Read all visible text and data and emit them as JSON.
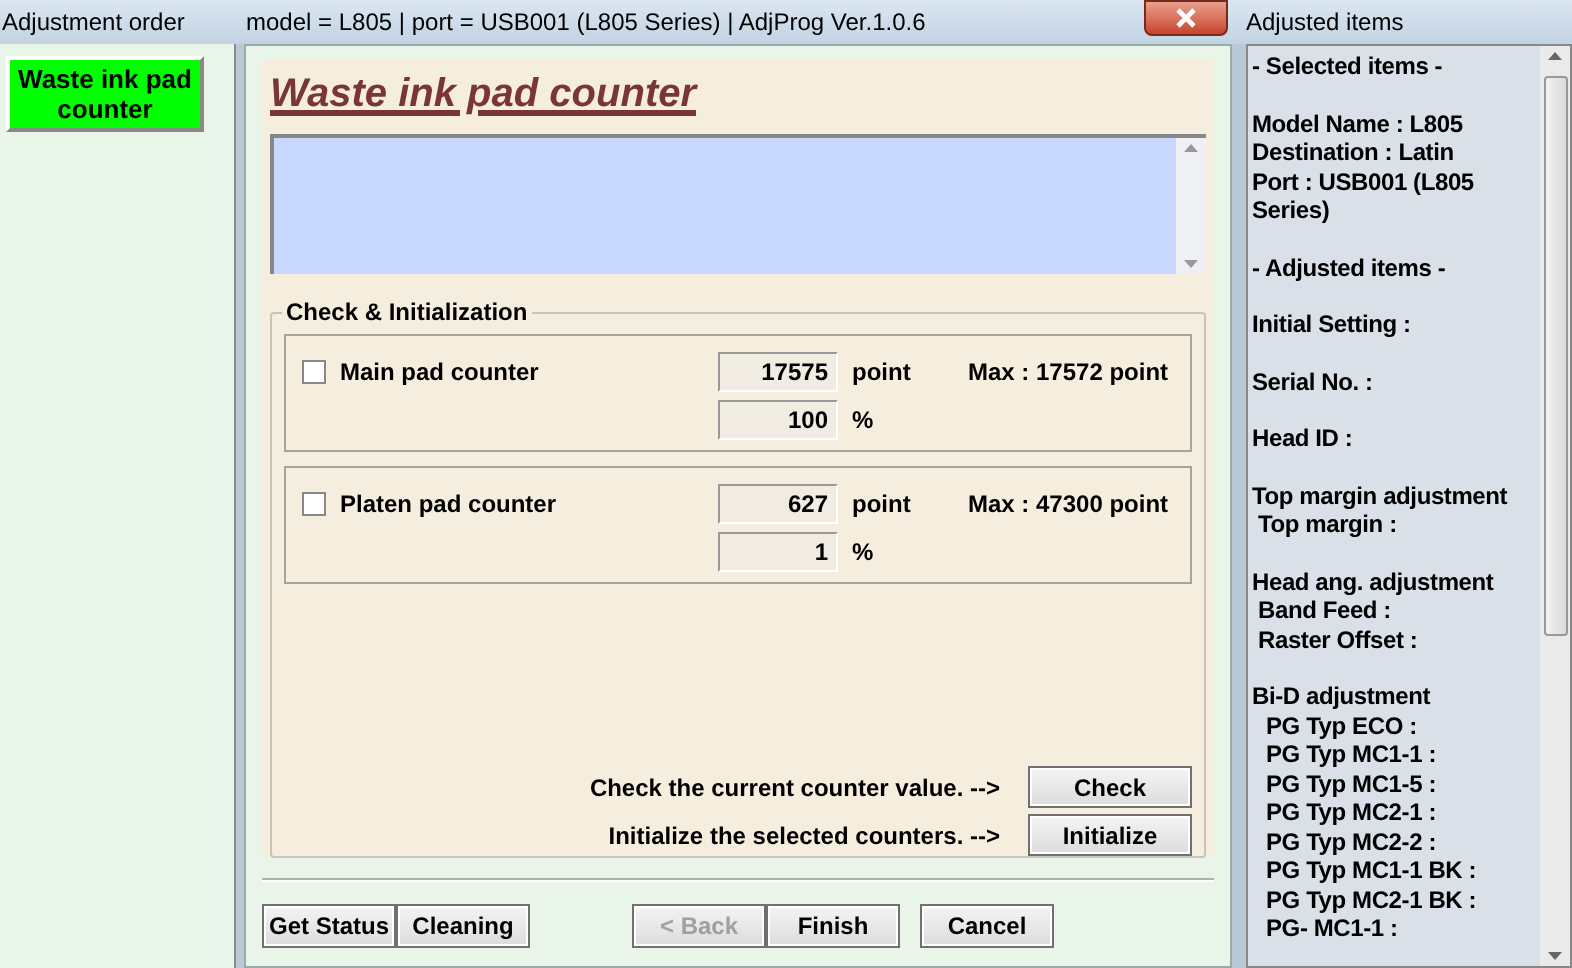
{
  "left_panel": {
    "title": "Adjustment order",
    "items": [
      {
        "label": "Waste ink pad counter",
        "selected": true
      }
    ]
  },
  "window": {
    "title": "model = L805 | port = USB001 (L805 Series) | AdjProg Ver.1.0.6",
    "heading": "Waste ink pad counter",
    "group": {
      "title": "Check & Initialization",
      "counters": [
        {
          "label": "Main pad counter",
          "checked": false,
          "value": "17575",
          "unit": "point",
          "max": "Max : 17572 point",
          "percent": "100",
          "percent_unit": "%"
        },
        {
          "label": "Platen pad counter",
          "checked": false,
          "value": "627",
          "unit": "point",
          "max": "Max : 47300 point",
          "percent": "1",
          "percent_unit": "%"
        }
      ],
      "actions": [
        {
          "hint": "Check the current counter value. -->",
          "button": "Check"
        },
        {
          "hint": "Initialize the selected counters. -->",
          "button": "Initialize"
        }
      ]
    },
    "left_buttons": [
      {
        "label": "Get Status",
        "disabled": false
      },
      {
        "label": "Cleaning",
        "disabled": false
      }
    ],
    "nav_buttons": [
      {
        "label": "< Back",
        "disabled": true
      },
      {
        "label": "Finish",
        "disabled": false
      },
      {
        "label": "Cancel",
        "disabled": false
      }
    ]
  },
  "right_panel": {
    "title": "Adjusted items",
    "groups": [
      {
        "lines": [
          "- Selected items -"
        ]
      },
      {
        "lines": [
          "Model Name : L805",
          "Destination : Latin",
          "Port : USB001 (L805 Series)"
        ]
      },
      {
        "lines": [
          "- Adjusted items -"
        ]
      },
      {
        "lines": [
          "Initial Setting :"
        ]
      },
      {
        "lines": [
          "Serial No. :"
        ]
      },
      {
        "lines": [
          "Head ID :"
        ]
      },
      {
        "lines": [
          "Top margin adjustment"
        ],
        "children": [
          "Top margin :"
        ]
      },
      {
        "lines": [
          "Head ang. adjustment"
        ],
        "children": [
          "Band Feed :",
          "Raster Offset :"
        ]
      },
      {
        "lines": [
          "Bi-D adjustment"
        ],
        "children": [
          "PG Typ ECO :",
          "PG Typ MC1-1 :",
          "PG Typ MC1-5 :",
          "PG Typ MC2-1 :",
          "PG Typ MC2-2 :",
          "PG Typ MC1-1 BK :",
          "PG Typ MC2-1 BK :",
          "PG- MC1-1 :"
        ]
      }
    ]
  }
}
